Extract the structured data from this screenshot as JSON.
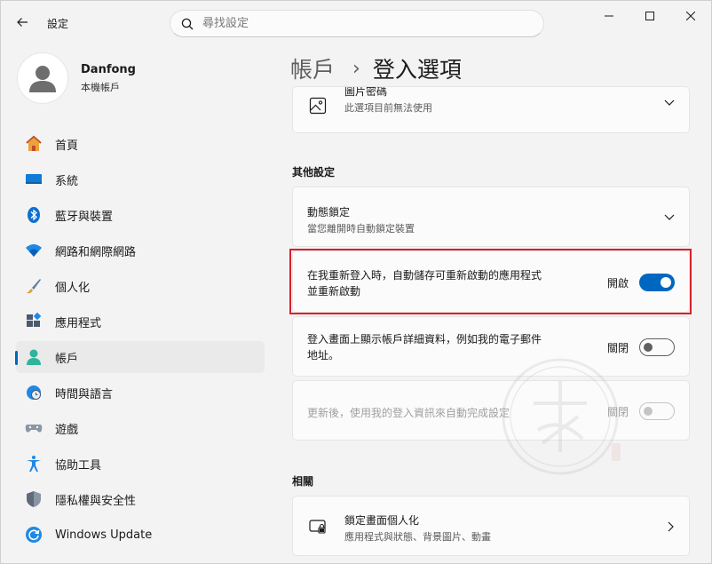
{
  "window": {
    "app_title": "設定",
    "search_placeholder": "尋找設定"
  },
  "profile": {
    "name": "Danfong",
    "account_type": "本機帳戶"
  },
  "nav": [
    {
      "label": "首頁",
      "icon": "home-icon"
    },
    {
      "label": "系統",
      "icon": "system-icon"
    },
    {
      "label": "藍牙與裝置",
      "icon": "bluetooth-icon"
    },
    {
      "label": "網路和網際網路",
      "icon": "wifi-icon"
    },
    {
      "label": "個人化",
      "icon": "brush-icon"
    },
    {
      "label": "應用程式",
      "icon": "apps-icon"
    },
    {
      "label": "帳戶",
      "icon": "account-icon",
      "active": true
    },
    {
      "label": "時間與語言",
      "icon": "clock-globe-icon"
    },
    {
      "label": "遊戲",
      "icon": "gamepad-icon"
    },
    {
      "label": "協助工具",
      "icon": "accessibility-icon"
    },
    {
      "label": "隱私權與安全性",
      "icon": "shield-icon"
    },
    {
      "label": "Windows Update",
      "icon": "update-icon"
    }
  ],
  "breadcrumb": {
    "parent": "帳戶",
    "separator": "›",
    "current": "登入選項"
  },
  "picture_password": {
    "title": "圖片密碼",
    "subtitle": "此選項目前無法使用"
  },
  "other_settings": {
    "heading": "其他設定",
    "dynamic_lock": {
      "title": "動態鎖定",
      "subtitle": "當您離開時自動鎖定裝置"
    },
    "restart_apps": {
      "line1": "在我重新登入時，自動儲存可重新啟動的應用程式",
      "line2": "並重新啟動",
      "state_label": "開啟",
      "on": true
    },
    "show_account_details": {
      "line1": "登入畫面上顯示帳戶詳細資料，例如我的電子郵件",
      "line2": "地址。",
      "state_label": "關閉",
      "on": false
    },
    "auto_finish_setup": {
      "title": "更新後，使用我的登入資訊來自動完成設定",
      "state_label": "關閉",
      "on": false,
      "disabled": true
    }
  },
  "related": {
    "heading": "相關",
    "lock_screen": {
      "title": "鎖定畫面個人化",
      "subtitle": "應用程式與狀態、背景圖片、動畫"
    }
  },
  "colors": {
    "accent": "#0067c0",
    "highlight": "#d9202a"
  }
}
